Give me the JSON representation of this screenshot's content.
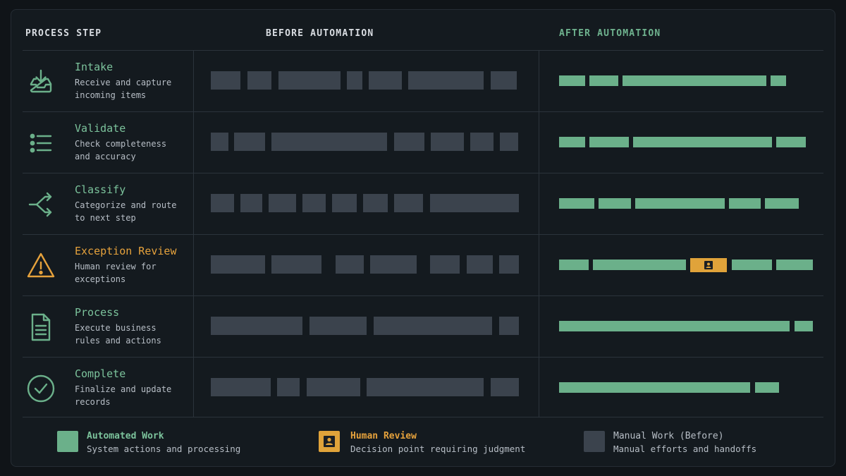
{
  "headers": {
    "step": "PROCESS STEP",
    "before": "BEFORE AUTOMATION",
    "after": "AFTER AUTOMATION"
  },
  "colors": {
    "automated": "#6bb08a",
    "human": "#e0a33a",
    "manual": "#3b434d",
    "accent_green": "#7cc39c",
    "accent_amber": "#e6a23c"
  },
  "steps": [
    {
      "title": "Intake",
      "desc": "Receive and capture\nincoming items",
      "icon": "inbox-download-icon",
      "before": [
        [
          299,
          42
        ],
        [
          351,
          34
        ],
        [
          395,
          88
        ],
        [
          492,
          22
        ],
        [
          523,
          47
        ],
        [
          579,
          107
        ],
        [
          696,
          37
        ]
      ],
      "after": [
        [
          793,
          37
        ],
        [
          836,
          41
        ],
        [
          883,
          204
        ],
        [
          1093,
          22
        ]
      ],
      "human": null
    },
    {
      "title": "Validate",
      "desc": "Check completeness\nand accuracy",
      "icon": "checklist-icon",
      "before": [
        [
          299,
          25
        ],
        [
          332,
          44
        ],
        [
          385,
          164
        ],
        [
          559,
          43
        ],
        [
          611,
          47
        ],
        [
          667,
          33
        ],
        [
          709,
          26
        ]
      ],
      "after": [
        [
          793,
          37
        ],
        [
          836,
          56
        ],
        [
          898,
          197
        ],
        [
          1101,
          42
        ]
      ],
      "human": null
    },
    {
      "title": "Classify",
      "desc": "Categorize and route\nto next step",
      "icon": "route-split-icon",
      "before": [
        [
          299,
          33
        ],
        [
          341,
          31
        ],
        [
          381,
          39
        ],
        [
          429,
          33
        ],
        [
          471,
          35
        ],
        [
          515,
          35
        ],
        [
          559,
          41
        ],
        [
          610,
          126
        ]
      ],
      "after": [
        [
          793,
          50
        ],
        [
          849,
          46
        ],
        [
          901,
          127
        ],
        [
          1034,
          45
        ],
        [
          1085,
          48
        ]
      ],
      "human": null
    },
    {
      "title": "Exception Review",
      "desc": "Human review for\nexceptions",
      "icon": "warning-triangle-icon",
      "before": [
        [
          299,
          77
        ],
        [
          385,
          71
        ],
        [
          476,
          40
        ],
        [
          525,
          66
        ],
        [
          610,
          42
        ],
        [
          662,
          37
        ],
        [
          708,
          28
        ]
      ],
      "after": [
        [
          793,
          42
        ],
        [
          841,
          132
        ],
        [
          1038,
          57
        ],
        [
          1101,
          52
        ]
      ],
      "human": [
        979,
        52
      ]
    },
    {
      "title": "Process",
      "desc": "Execute business\nrules and actions",
      "icon": "document-icon",
      "before": [
        [
          299,
          130
        ],
        [
          439,
          81
        ],
        [
          530,
          168
        ],
        [
          708,
          28
        ]
      ],
      "after": [
        [
          793,
          327
        ],
        [
          1127,
          26
        ]
      ],
      "human": null
    },
    {
      "title": "Complete",
      "desc": "Finalize and update\nrecords",
      "icon": "check-circle-icon",
      "before": [
        [
          299,
          85
        ],
        [
          393,
          32
        ],
        [
          435,
          76
        ],
        [
          520,
          166
        ],
        [
          696,
          40
        ]
      ],
      "after": [
        [
          793,
          271
        ],
        [
          1071,
          34
        ]
      ],
      "human": null
    }
  ],
  "legend": [
    {
      "title": "Automated Work",
      "desc": "System actions and processing",
      "type": "automated"
    },
    {
      "title": "Human Review",
      "desc": "Decision point requiring judgment",
      "type": "human"
    },
    {
      "title": "Manual Work (Before)",
      "desc": "Manual efforts and handoffs",
      "type": "manual"
    }
  ]
}
